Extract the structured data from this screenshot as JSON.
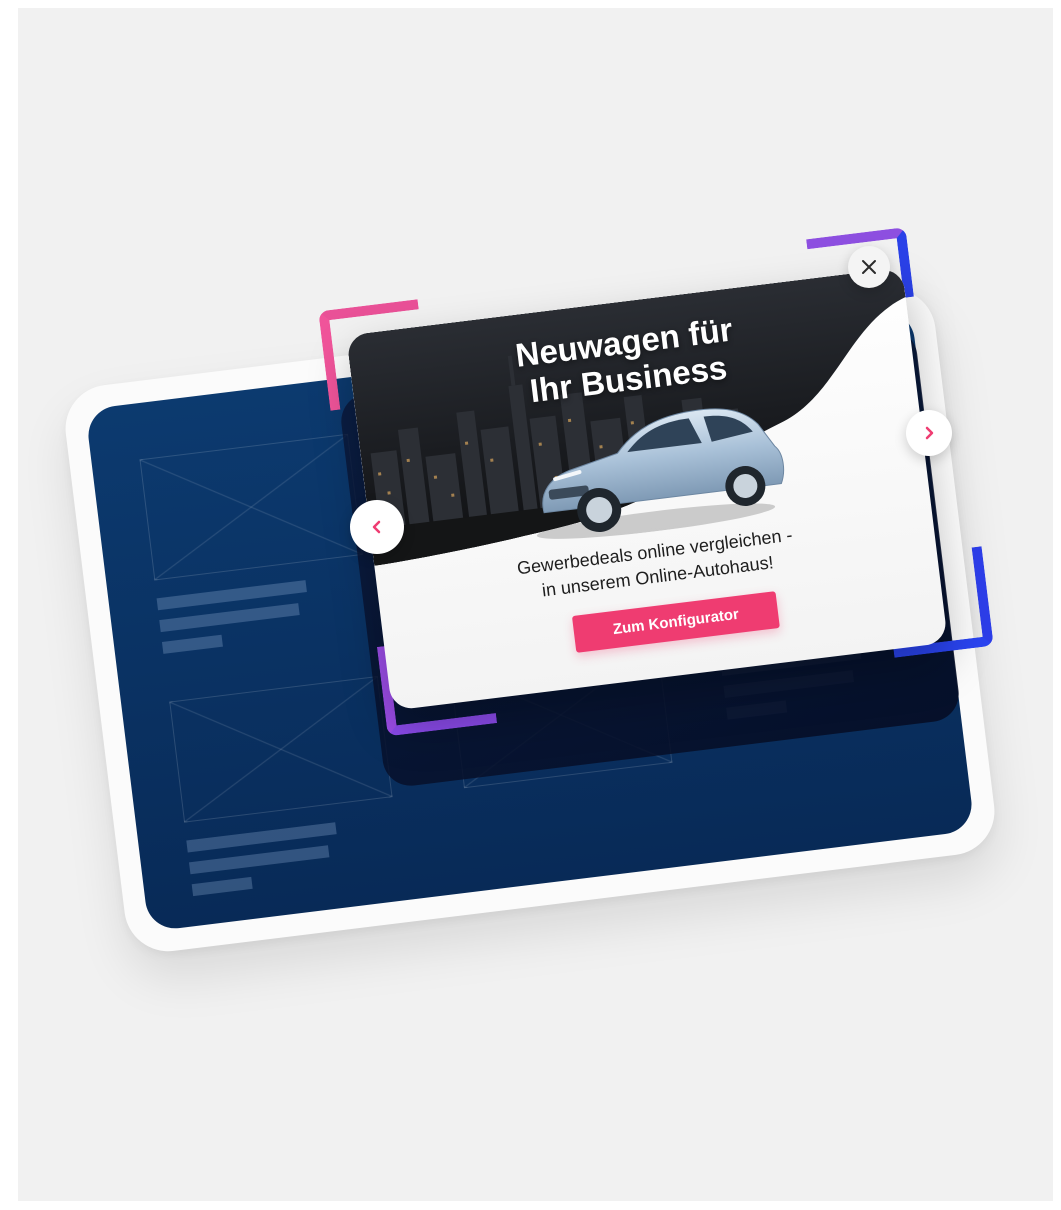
{
  "popup": {
    "headline_line1": "Neuwagen für",
    "headline_line2": "Ihr Business",
    "tagline_line1": "Gewerbedeals online vergleichen -",
    "tagline_line2": "in unserem Online-Autohaus!",
    "cta_label": "Zum Konfigurator"
  },
  "icons": {
    "close": "close-icon",
    "prev": "chevron-left-icon",
    "next": "chevron-right-icon",
    "hero": "car-city-night-image"
  },
  "colors": {
    "cta": "#ef3c71",
    "accent_pink": "#f0549a",
    "accent_purple": "#8d4fe0",
    "accent_blue": "#2a41e8",
    "device_screen": "#0c3a6f"
  }
}
